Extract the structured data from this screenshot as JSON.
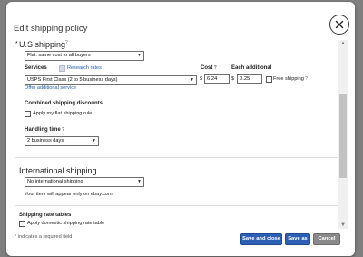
{
  "dialog": {
    "title": "Edit shipping policy",
    "close_icon": "close-icon"
  },
  "us_shipping": {
    "title": "U.S shipping",
    "cost_type_selected": "Flat: same cost to all buyers",
    "services_label": "Services",
    "research_rates_link": "Research rates",
    "service_selected": "USPS First Class (2 to 5 business days)",
    "offer_additional_link": "Offer additional service",
    "cost_label": "Cost",
    "currency_symbol": "$",
    "cost_value": "6.24",
    "each_additional_label": "Each additional",
    "each_additional_currency": "$",
    "each_additional_value": "0.25",
    "free_shipping_label": "Free shipping",
    "combined_discounts_label": "Combined shipping discounts",
    "apply_flat_rule_label": "Apply my flat shipping rule",
    "handling_time_label": "Handling time",
    "handling_time_selected": "2 business days"
  },
  "international_shipping": {
    "title": "International shipping",
    "selected": "No international shipping",
    "note": "Your item will appear only on ebay.com."
  },
  "rate_tables": {
    "label": "Shipping rate tables",
    "apply_domestic_label": "Apply domestic shipping rate table"
  },
  "footer": {
    "required_marker": "*",
    "required_note": "indicates a required field",
    "save_close_label": "Save and close",
    "save_as_label": "Save as",
    "cancel_label": "Cancel"
  },
  "colors": {
    "primary_button": "#2d5fb5",
    "required_marker": "#2e9a2e",
    "link": "#1f5fa8"
  }
}
